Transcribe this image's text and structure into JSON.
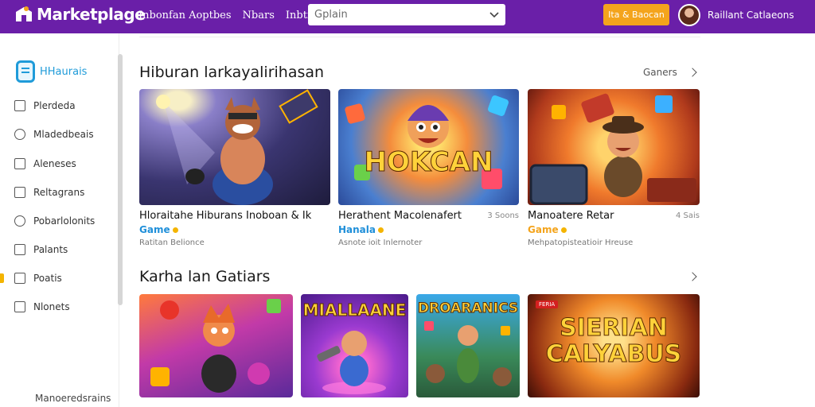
{
  "header": {
    "brand": "Marketplage",
    "nav": [
      "Inbonfan Aoptbes",
      "Nbars",
      "Inbtins"
    ],
    "search_placeholder": "Gplain",
    "cta_label": "Ita & Baocan",
    "username": "Raillant Catlaeons"
  },
  "sidebar": {
    "brand_label": "HHaurais",
    "items": [
      {
        "label": "Plerdeda",
        "icon": "document-icon"
      },
      {
        "label": "Mladedbeais",
        "icon": "user-icon"
      },
      {
        "label": "Aleneses",
        "icon": "file-icon"
      },
      {
        "label": "Reltagrans",
        "icon": "edit-icon"
      },
      {
        "label": "Pobarlolonits",
        "icon": "location-icon"
      },
      {
        "label": "Palants",
        "icon": "list-icon"
      },
      {
        "label": "Poatis",
        "icon": "square-icon"
      },
      {
        "label": "Nlonets",
        "icon": "box-icon"
      }
    ],
    "footer": "Manoeredsrains"
  },
  "sections": [
    {
      "title": "Hiburan larkayalirihasan",
      "more_label": "Ganers",
      "cards": [
        {
          "title": "Hloraitahe Hiburans Inoboan & Ik",
          "category": "Game",
          "category_color": "#1f8fd9",
          "subtitle": "Ratitan Belionce",
          "meta": ""
        },
        {
          "title": "Herathent Macolenafert",
          "category": "Hanala",
          "category_color": "#1f8fd9",
          "subtitle": "Asnote ioit Inlernoter",
          "meta": "3 Soons",
          "thumb_text": "HOKCAN"
        },
        {
          "title": "Manoatere Retar",
          "category": "Game",
          "category_color": "#f4a41c",
          "subtitle": "Mehpatopisteatioir Hreuse",
          "meta": "4 Sais"
        }
      ]
    },
    {
      "title": "Karha lan Gatiars",
      "more_label": "",
      "cards": [
        {
          "title": "",
          "thumb_text": ""
        },
        {
          "title": "",
          "thumb_text": "MIALLAANE"
        },
        {
          "title": "",
          "thumb_text": "DROARANICS"
        },
        {
          "title": "",
          "thumb_text": "SIERIAN CALYABUS",
          "badge": "FERIA"
        }
      ]
    }
  ]
}
